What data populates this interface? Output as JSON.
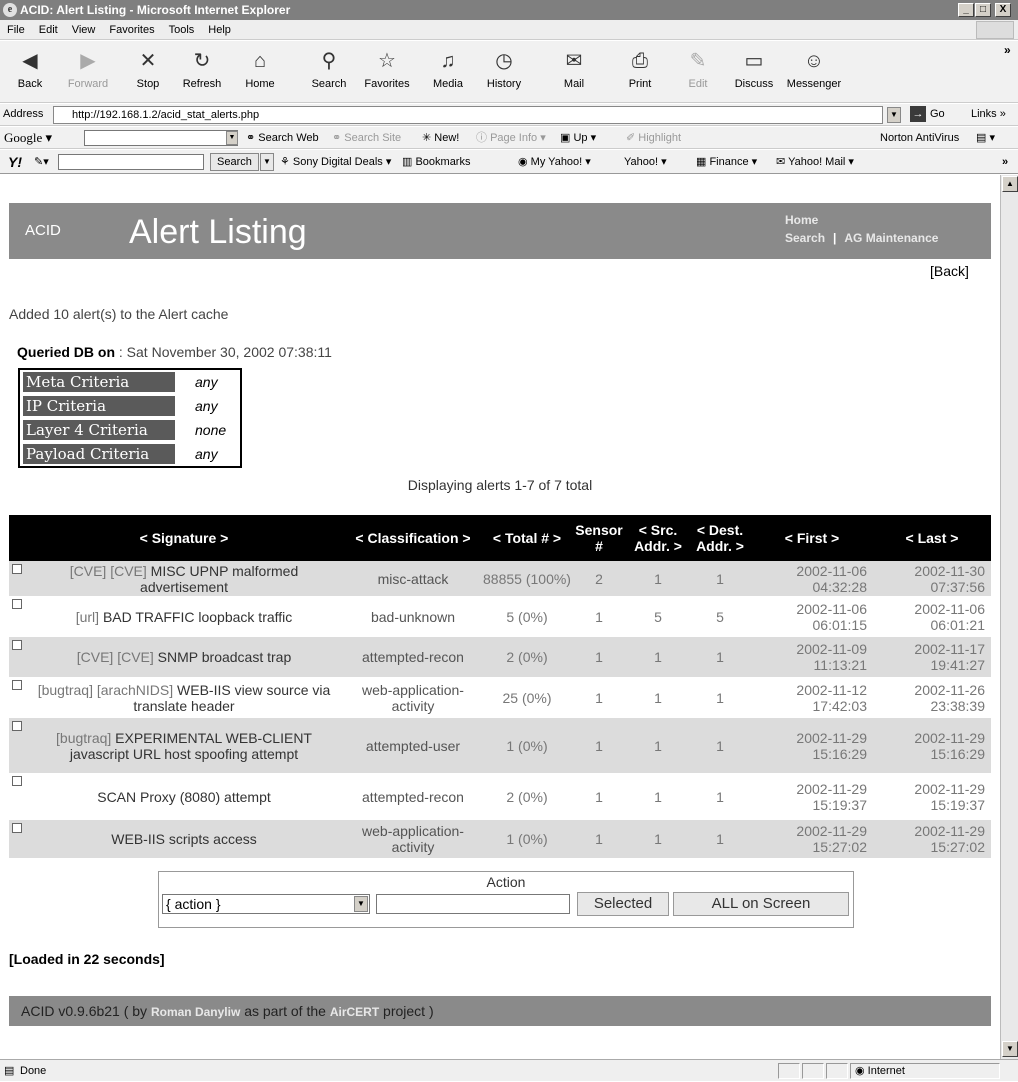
{
  "window": {
    "title": "ACID: Alert Listing - Microsoft Internet Explorer",
    "min": "_",
    "max": "□",
    "close": "X"
  },
  "menu": [
    "File",
    "Edit",
    "View",
    "Favorites",
    "Tools",
    "Help"
  ],
  "toolbar": {
    "back": "Back",
    "forward": "Forward",
    "stop": "Stop",
    "refresh": "Refresh",
    "home": "Home",
    "search": "Search",
    "favorites": "Favorites",
    "media": "Media",
    "history": "History",
    "mail": "Mail",
    "print": "Print",
    "edit": "Edit",
    "discuss": "Discuss",
    "messenger": "Messenger",
    "more": "»"
  },
  "address": {
    "label": "Address",
    "url": "http://192.168.1.2/acid_stat_alerts.php",
    "go": "Go",
    "links": "Links »"
  },
  "google_bar": {
    "logo": "Google ▾",
    "search_web": "Search Web",
    "search_site": "Search Site",
    "new": "New!",
    "page_info": "Page Info ▾",
    "up": "Up ▾",
    "highlight": "Highlight",
    "norton": "Norton AntiVirus"
  },
  "yahoo_bar": {
    "logo": "Y!",
    "search": "Search",
    "sony": "Sony Digital Deals ▾",
    "bookmarks": "Bookmarks",
    "my_yahoo": "My Yahoo! ▾",
    "yahoo": "Yahoo! ▾",
    "finance": "Finance ▾",
    "mail": "Yahoo! Mail ▾",
    "more": "»"
  },
  "page": {
    "app": "ACID",
    "title": "Alert Listing",
    "home_link": "Home",
    "search_link": "Search",
    "separator": "|",
    "maintenance_link": "AG Maintenance",
    "back": "[Back]",
    "cache_msg": "Added 10 alert(s) to the Alert cache",
    "queried_label": "Queried DB on",
    "queried_value": " : Sat November 30, 2002 07:38:11",
    "criteria": [
      {
        "label": "Meta Criteria",
        "value": "any"
      },
      {
        "label": "IP Criteria",
        "value": "any"
      },
      {
        "label": "Layer 4 Criteria",
        "value": "none"
      },
      {
        "label": "Payload Criteria",
        "value": "any"
      }
    ],
    "displaying": "Displaying alerts 1-7 of 7 total",
    "columns": [
      "< Signature >",
      "< Classification >",
      "< Total # >",
      "Sensor #",
      "< Src. Addr. >",
      "< Dest. Addr. >",
      "< First >",
      "< Last >"
    ],
    "rows": [
      {
        "refs": "[CVE] [CVE]",
        "sig": " MISC UPNP malformed advertisement",
        "class": "misc-attack",
        "total": "88855 (100%)",
        "sensor": "2",
        "src": "1",
        "dst": "1",
        "first": "2002-11-06 04:32:28",
        "last": "2002-11-30 07:37:56"
      },
      {
        "refs": "[url]",
        "sig": " BAD TRAFFIC loopback traffic",
        "class": "bad-unknown",
        "total": "5 (0%)",
        "sensor": "1",
        "src": "5",
        "dst": "5",
        "first": "2002-11-06 06:01:15",
        "last": "2002-11-06 06:01:21"
      },
      {
        "refs": "[CVE] [CVE]",
        "sig": " SNMP broadcast trap",
        "class": "attempted-recon",
        "total": "2 (0%)",
        "sensor": "1",
        "src": "1",
        "dst": "1",
        "first": "2002-11-09 11:13:21",
        "last": "2002-11-17 19:41:27"
      },
      {
        "refs": "[bugtraq] [arachNIDS]",
        "sig": " WEB-IIS view source via translate header",
        "class": "web-application-activity",
        "total": "25 (0%)",
        "sensor": "1",
        "src": "1",
        "dst": "1",
        "first": "2002-11-12 17:42:03",
        "last": "2002-11-26 23:38:39"
      },
      {
        "refs": "[bugtraq]",
        "sig": " EXPERIMENTAL WEB-CLIENT javascript URL host spoofing attempt",
        "class": "attempted-user",
        "total": "1 (0%)",
        "sensor": "1",
        "src": "1",
        "dst": "1",
        "first": "2002-11-29 15:16:29",
        "last": "2002-11-29 15:16:29"
      },
      {
        "refs": "",
        "sig": "SCAN Proxy (8080) attempt",
        "class": "attempted-recon",
        "total": "2 (0%)",
        "sensor": "1",
        "src": "1",
        "dst": "1",
        "first": "2002-11-29 15:19:37",
        "last": "2002-11-29 15:19:37"
      },
      {
        "refs": "",
        "sig": "WEB-IIS scripts access",
        "class": "web-application-activity",
        "total": "1 (0%)",
        "sensor": "1",
        "src": "1",
        "dst": "1",
        "first": "2002-11-29 15:27:02",
        "last": "2002-11-29 15:27:02"
      }
    ],
    "action_caption": "Action",
    "action_select": "{ action }",
    "selected_btn": "Selected",
    "all_btn": "ALL on Screen",
    "loaded": "[Loaded in 22 seconds]",
    "footer_pre": "ACID v0.9.6b21 ( by ",
    "footer_author": "Roman Danyliw",
    "footer_mid": " as part of the ",
    "footer_project": "AirCERT",
    "footer_post": " project )"
  },
  "status": {
    "text": "Done",
    "zone": "Internet"
  }
}
